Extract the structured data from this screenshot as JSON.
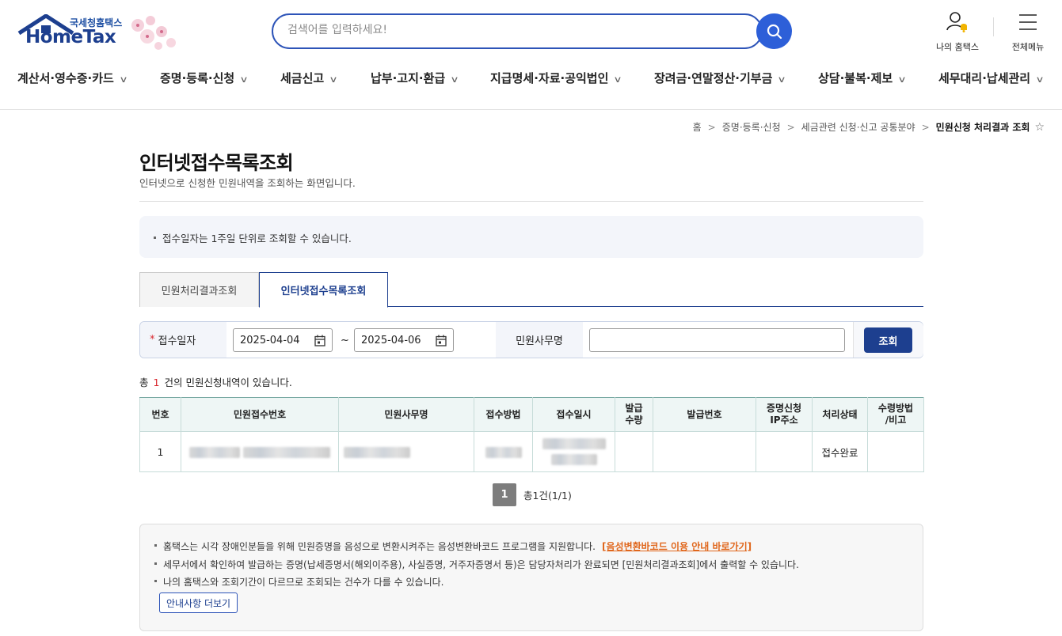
{
  "header": {
    "logo_sub": "국세청홈택스",
    "logo_main": "HomeTax",
    "search_placeholder": "검색어를 입력하세요!",
    "my_hometax": "나의 홈택스",
    "all_menu": "전체메뉴"
  },
  "gnb": [
    {
      "label": "계산서·영수증·카드"
    },
    {
      "label": "증명·등록·신청"
    },
    {
      "label": "세금신고"
    },
    {
      "label": "납부·고지·환급"
    },
    {
      "label": "지급명세·자료·공익법인"
    },
    {
      "label": "장려금·연말정산·기부금"
    },
    {
      "label": "상담·불복·제보"
    },
    {
      "label": "세무대리·납세관리"
    }
  ],
  "breadcrumb": {
    "home": "홈",
    "level1": "증명·등록·신청",
    "level2": "세금관련 신청·신고 공통분야",
    "current": "민원신청 처리결과 조회"
  },
  "page": {
    "title": "인터넷접수목록조회",
    "desc": "인터넷으로 신청한 민원내역을 조회하는 화면입니다."
  },
  "notice": "접수일자는 1주일 단위로 조회할 수 있습니다.",
  "tabs": [
    {
      "label": "민원처리결과조회",
      "active": false
    },
    {
      "label": "인터넷접수목록조회",
      "active": true
    }
  ],
  "search": {
    "date_label": "접수일자",
    "date_from": "2025-04-04",
    "date_to": "2025-04-06",
    "tilde": "~",
    "office_label": "민원사무명",
    "office_value": "",
    "button": "조회"
  },
  "count": {
    "prefix": "총",
    "value": "1",
    "suffix": "건의 민원신청내역이 있습니다."
  },
  "table": {
    "headers": [
      "번호",
      "민원접수번호",
      "민원사무명",
      "접수방법",
      "접수일시",
      "발급\n수량",
      "발급번호",
      "증명신청\nIP주소",
      "처리상태",
      "수령방법\n/비고"
    ],
    "rows": [
      {
        "no": "1",
        "status": "접수완료"
      }
    ]
  },
  "pager": {
    "page": "1",
    "total": "총1건(1/1)"
  },
  "info": {
    "line1": "홈택스는 시각 장애인분들을 위해 민원증명을 음성으로 변환시켜주는 음성변환바코드 프로그램을 지원합니다.",
    "line1_link": "[음성변환바코드 이용 안내 바로가기]",
    "line2": "세무서에서 확인하여 발급하는 증명(납세증명서(해외이주용), 사실증명, 거주자증명서 등)은 담당자처리가 완료되면 [민원처리결과조회]에서 출력할 수 있습니다.",
    "line3": "나의 홈택스와 조회기간이 다르므로 조회되는 건수가 다를 수 있습니다.",
    "more_button": "안내사항 더보기"
  },
  "colors": {
    "brand": "#1d3f8f",
    "accent": "#2d5fd8",
    "required": "#d9282f",
    "link": "#e0661b"
  }
}
